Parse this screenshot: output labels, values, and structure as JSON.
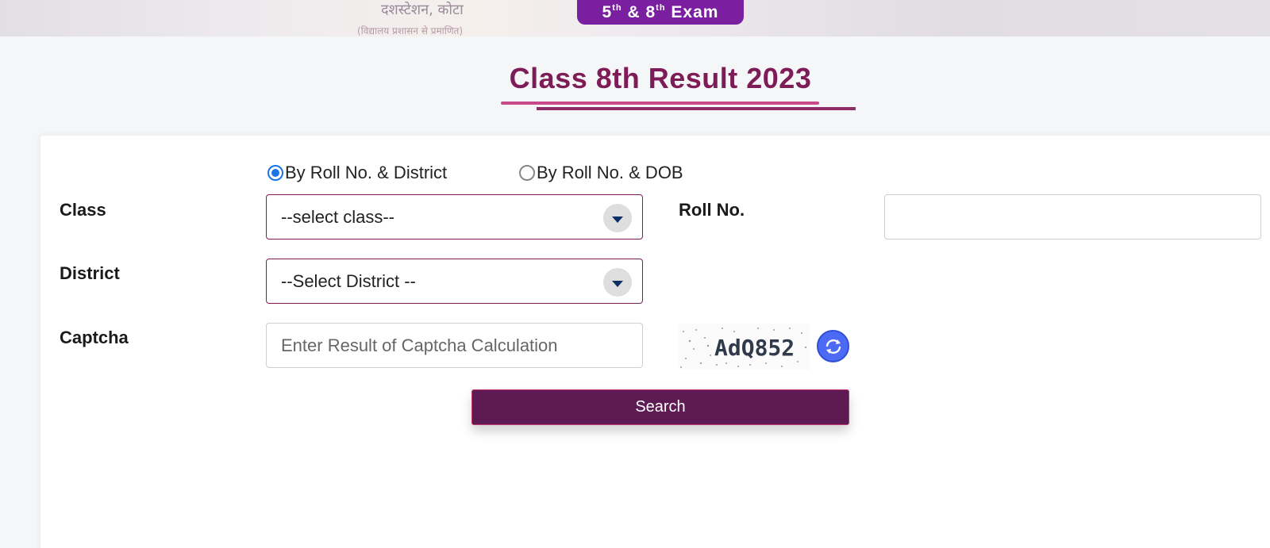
{
  "banner": {
    "hindi_text": "दशस्टेशन, कोटा",
    "hindi_subtext": "(विद्यालय प्रशासन से प्रमाणित)",
    "exam_badge": {
      "grade_a": "5",
      "sup_a": "th",
      "amp": "&",
      "grade_b": "8",
      "sup_b": "th",
      "label": "Exam"
    }
  },
  "page": {
    "title": "Class 8th Result 2023"
  },
  "form": {
    "radio_options": [
      {
        "label": "By Roll No. & District",
        "checked": true
      },
      {
        "label": "By Roll No. & DOB",
        "checked": false
      }
    ],
    "class_label": "Class",
    "class_select_value": "--select class--",
    "roll_label": "Roll No.",
    "roll_value": "",
    "district_label": "District",
    "district_select_value": "--Select District --",
    "captcha_label": "Captcha",
    "captcha_placeholder": "Enter Result of Captcha Calculation",
    "captcha_text": "AdQ852",
    "search_label": "Search"
  },
  "colors": {
    "brand": "#7d1c56",
    "badge": "#7a1fa0",
    "button": "#5e1b53",
    "radio_checked": "#1a73e8",
    "refresh": "#4d6af5"
  },
  "icons": {
    "dropdown": "chevron-down-icon",
    "refresh": "refresh-icon"
  }
}
